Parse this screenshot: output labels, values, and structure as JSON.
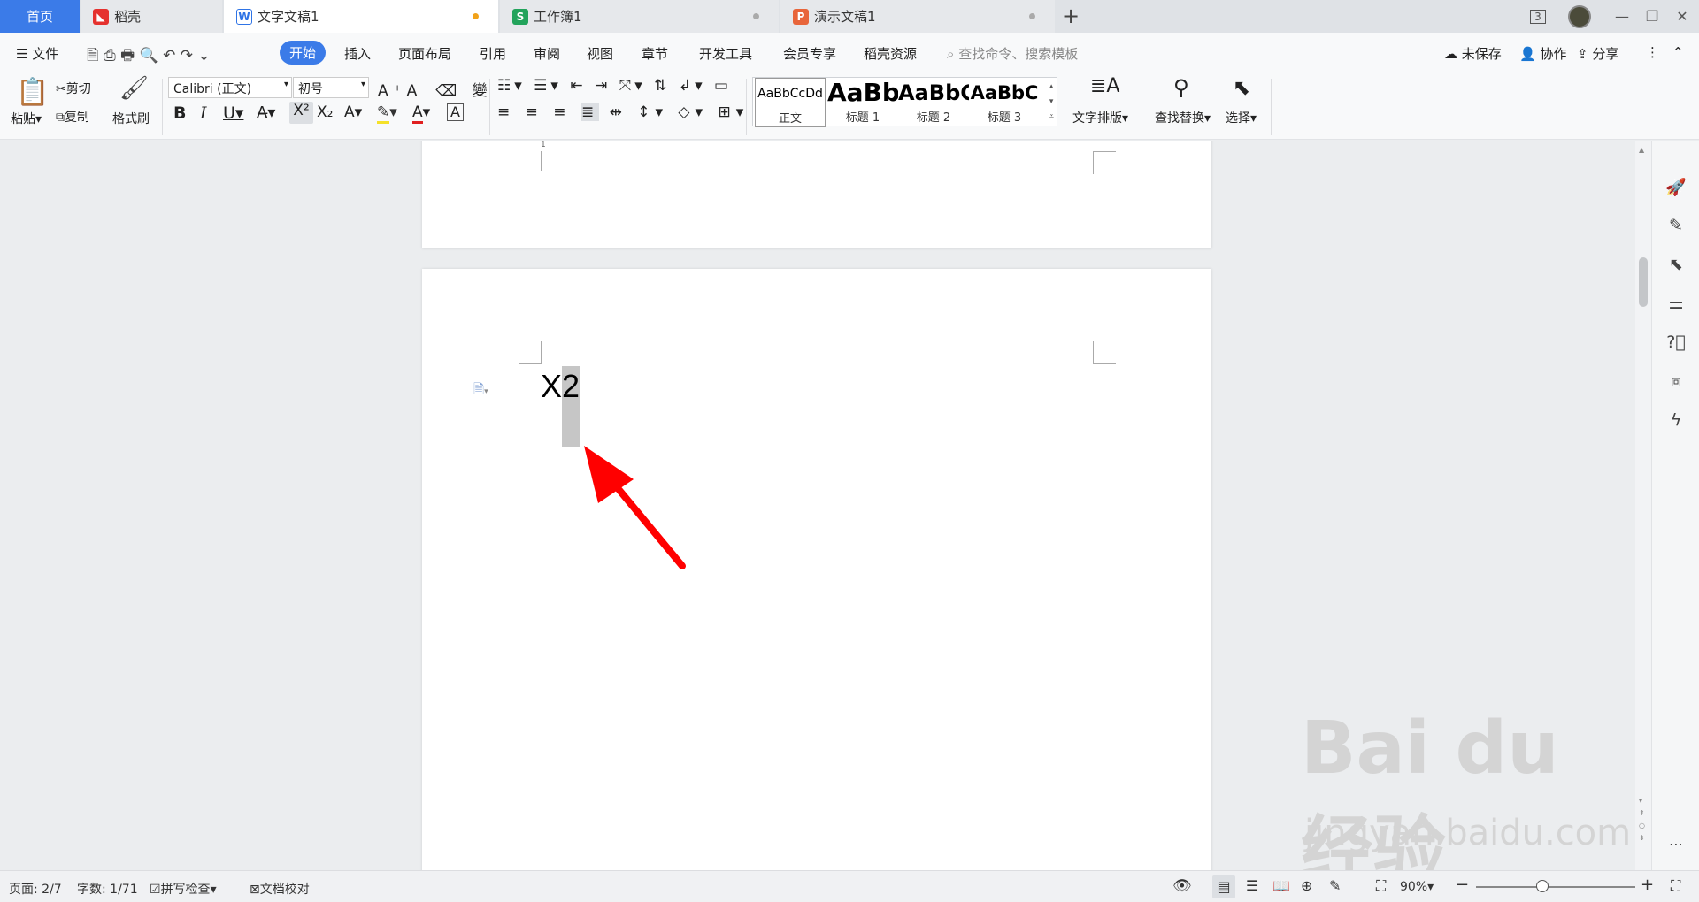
{
  "tabs": {
    "home": "首页",
    "daoke": "稻壳",
    "doc": "文字文稿1",
    "sheet": "工作簿1",
    "ppt": "演示文稿1",
    "badge": "3"
  },
  "menu": {
    "file": "文件",
    "home": "开始",
    "insert": "插入",
    "layout": "页面布局",
    "ref": "引用",
    "review": "审阅",
    "view": "视图",
    "section": "章节",
    "dev": "开发工具",
    "member": "会员专享",
    "resource": "稻壳资源",
    "search_placeholder": "查找命令、搜索模板",
    "unsaved": "未保存",
    "collab": "协作",
    "share": "分享"
  },
  "toolbar": {
    "paste": "粘贴",
    "cut": "剪切",
    "copy": "复制",
    "format_painter": "格式刷",
    "font_name": "Calibri (正文)",
    "font_size": "初号",
    "text_layout": "文字排版",
    "find_replace": "查找替换",
    "select": "选择"
  },
  "styles": [
    {
      "preview": "AaBbCcDd",
      "label": "正文"
    },
    {
      "preview": "AaBb",
      "label": "标题 1"
    },
    {
      "preview": "AaBbC",
      "label": "标题 2"
    },
    {
      "preview": "AaBbC",
      "label": "标题 3"
    }
  ],
  "document": {
    "body_text": "X",
    "selected_text": "2",
    "ruler_mark": "1"
  },
  "status": {
    "page": "页面: 2/7",
    "words": "字数: 1/71",
    "spell": "拼写检查",
    "proof": "文档校对",
    "zoom": "90%"
  },
  "watermark": {
    "logo": "Bai du 经验",
    "url": "jingyan.baidu.com"
  },
  "colors": {
    "accent": "#3b7be8",
    "arrow": "#ff0000",
    "selection": "#c6c6c6"
  }
}
